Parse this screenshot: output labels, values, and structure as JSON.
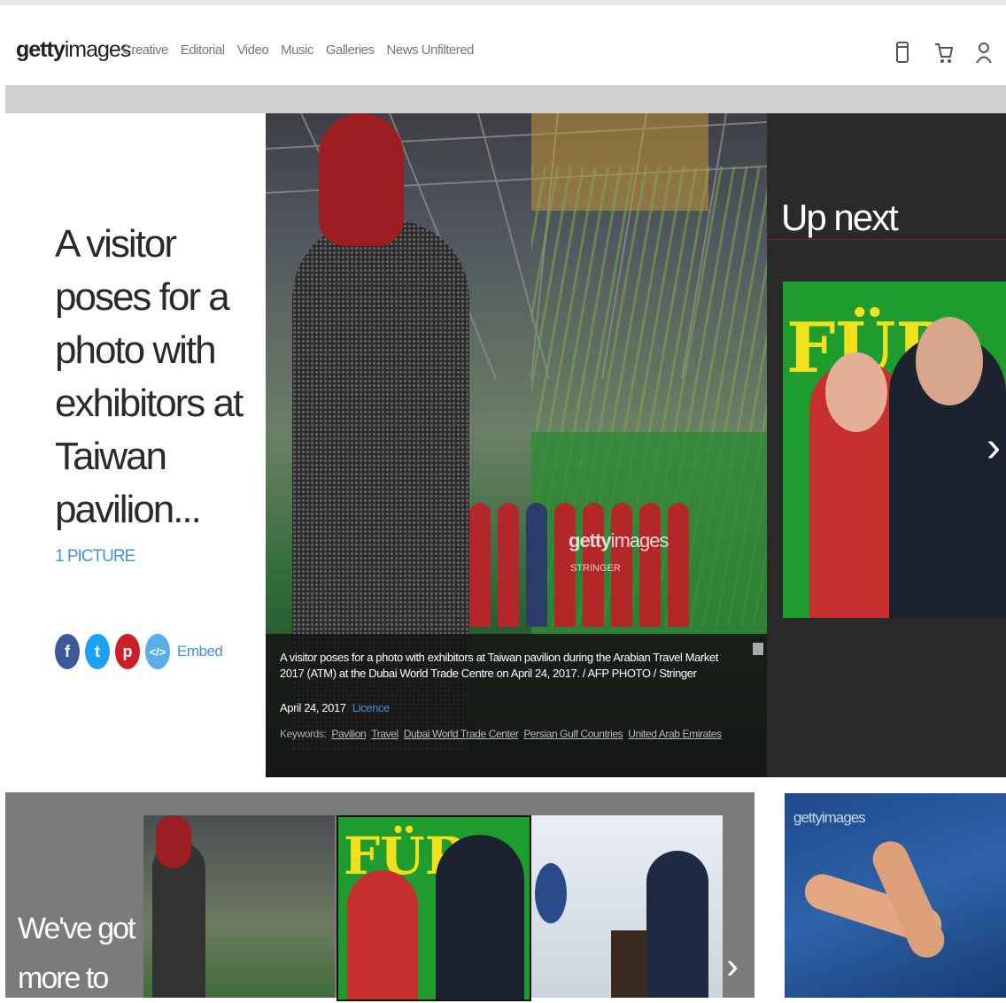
{
  "header": {
    "logo_bold": "getty",
    "logo_light": "images",
    "nav": [
      "Creative",
      "Editorial",
      "Video",
      "Music",
      "Galleries",
      "News Unfiltered"
    ],
    "icons": [
      "board-icon",
      "cart-icon",
      "user-icon"
    ]
  },
  "gallery": {
    "title": "A visitor poses for a photo with exhibitors at Taiwan pavilion...",
    "picture_count": "1 PICTURE",
    "share": {
      "facebook": "f",
      "twitter": "t",
      "pinterest": "p",
      "embed_icon": "</>",
      "embed_label": "Embed"
    }
  },
  "main_image": {
    "watermark_brand_bold": "getty",
    "watermark_brand_light": "images",
    "watermark_credit": "STRINGER",
    "caption": "A visitor poses for a photo with exhibitors at Taiwan pavilion during the Arabian Travel Market 2017 (ATM) at the Dubai World Trade Centre on April 24, 2017. / AFP PHOTO / Stringer",
    "date": "April 24, 2017",
    "licence_label": "Licence",
    "keywords_label": "Keywords:",
    "keywords": [
      "Pavilion",
      "Travel",
      "Dubai World Trade Center",
      "Persian Gulf Countries",
      "United Arab Emirates"
    ]
  },
  "up_next": {
    "label": "Up next",
    "image_text": "FÜR",
    "arrow": "›"
  },
  "bottom": {
    "more_text": "We've got more to",
    "thumb_text": "FÜR",
    "arrow": "›",
    "side_watermark": "gettyimages"
  },
  "colors": {
    "accent_blue": "#4a90d9",
    "facebook": "#3b5998",
    "twitter": "#1da1f2",
    "pinterest": "#cb2027",
    "upnext_bg": "#2a2a2a"
  }
}
